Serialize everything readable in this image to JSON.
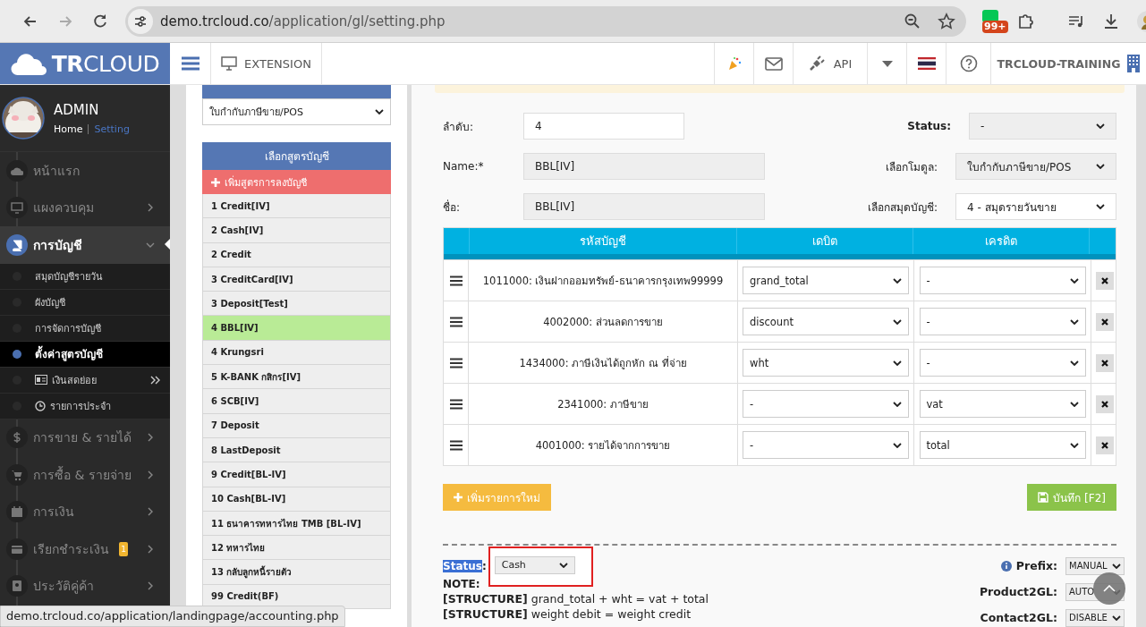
{
  "browser": {
    "url_domain": "demo.trcloud.co",
    "url_path": "/application/gl/setting.php",
    "extension_badge": "99+"
  },
  "header": {
    "logo": "**TR**CLOUD",
    "extension": "EXTENSION",
    "api": "API",
    "company": "TRCLOUD-TRAINING"
  },
  "profile": {
    "name": "ADMIN",
    "home": "Home",
    "setting": "Setting"
  },
  "sidebar": {
    "items": [
      {
        "label": "หน้าแรก",
        "kind": "link",
        "selected": false
      },
      {
        "label": "แผงควบคุม",
        "kind": "menu",
        "selected": false,
        "expanded": false
      },
      {
        "label": "การบัญชี",
        "kind": "menu",
        "selected": true,
        "expanded": true,
        "children": [
          {
            "label": "สมุดบัญชีรายวัน",
            "kind": "plain",
            "selected": false
          },
          {
            "label": "ผังบัญชี",
            "kind": "plain",
            "selected": false
          },
          {
            "label": "การจัดการบัญชี",
            "kind": "plain",
            "selected": false
          },
          {
            "label": "ตั้งค่าสูตรบัญชี",
            "kind": "plain",
            "selected": true
          },
          {
            "label": "เงินสดย่อย",
            "kind": "submenu",
            "selected": false
          },
          {
            "label": "รายการประจำ",
            "kind": "icon",
            "selected": false
          }
        ]
      },
      {
        "label": "การขาย & รายได้",
        "kind": "menu",
        "selected": false,
        "expanded": false
      },
      {
        "label": "การซื้อ & รายจ่าย",
        "kind": "menu",
        "selected": false,
        "expanded": false
      },
      {
        "label": "การเงิน",
        "kind": "menu",
        "selected": false,
        "expanded": false
      },
      {
        "label": "เรียกชำระเงิน",
        "kind": "menu",
        "selected": false,
        "expanded": false,
        "badge": "1"
      },
      {
        "label": "ประวัติคู่ค้า",
        "kind": "menu",
        "selected": false,
        "expanded": false
      }
    ]
  },
  "module_select": {
    "value": "ใบกำกับภาษีขาย/POS"
  },
  "formulas": {
    "title": "เลือกสูตรบัญชี",
    "add_label": "เพิ่มสูตรการลงบัญชี",
    "items": [
      {
        "label": "1 Credit[IV]",
        "selected": false
      },
      {
        "label": "2 Cash[IV]",
        "selected": false
      },
      {
        "label": "2 Credit",
        "selected": false
      },
      {
        "label": "3 CreditCard[IV]",
        "selected": false
      },
      {
        "label": "3 Deposit[Test]",
        "selected": false
      },
      {
        "label": "4 BBL[IV]",
        "selected": true
      },
      {
        "label": "4 Krungsri",
        "selected": false
      },
      {
        "label": "5 K-BANK กสิกร[IV]",
        "selected": false
      },
      {
        "label": "6 SCB[IV]",
        "selected": false
      },
      {
        "label": "7 Deposit",
        "selected": false
      },
      {
        "label": "8 LastDeposit",
        "selected": false
      },
      {
        "label": "9 Credit[BL-IV]",
        "selected": false
      },
      {
        "label": "10 Cash[BL-IV]",
        "selected": false
      },
      {
        "label": "11 ธนาคารทหารไทย TMB [BL-IV]",
        "selected": false
      },
      {
        "label": "12 ทหารไทย",
        "selected": false
      },
      {
        "label": "13 กลับลูกหนี้รายตัว",
        "selected": false
      },
      {
        "label": "99 Credit(BF)",
        "selected": false
      }
    ]
  },
  "form": {
    "rows": [
      {
        "left": {
          "label": "ลำดับ:",
          "value": "4",
          "kind": "input"
        },
        "right": {
          "label": "Status:",
          "value": "-",
          "kind": "select_grey",
          "bold": true
        }
      },
      {
        "left": {
          "label": "Name:*",
          "value": "BBL[IV]",
          "kind": "readonly"
        },
        "right": {
          "label": "เลือกโมดูล:",
          "value": "ใบกำกับภาษีขาย/POS",
          "kind": "select_grey",
          "bold": false
        }
      },
      {
        "left": {
          "label": "ชื่อ:",
          "value": "BBL[IV]",
          "kind": "readonly"
        },
        "right": {
          "label": "เลือกสมุดบัญชี:",
          "value": "4 - สมุดรายวันขาย",
          "kind": "select",
          "bold": false
        }
      }
    ]
  },
  "table": {
    "columns": [
      "รหัสบัญชี",
      "เดบิต",
      "เครดิต"
    ],
    "rows": [
      {
        "account": "1011000: เงินฝากออมทรัพย์-ธนาคารกรุงเทพ99999",
        "debit": "grand_total",
        "credit": "-"
      },
      {
        "account": "4002000: ส่วนลดการขาย",
        "debit": "discount",
        "credit": "-"
      },
      {
        "account": "1434000: ภาษีเงินได้ถูกหัก ณ ที่จ่าย",
        "debit": "wht",
        "credit": "-"
      },
      {
        "account": "2341000: ภาษีขาย",
        "debit": "-",
        "credit": "vat"
      },
      {
        "account": "4001000: รายได้จากการขาย",
        "debit": "-",
        "credit": "total"
      }
    ]
  },
  "buttons": {
    "add_row": "เพิ่มรายการใหม่",
    "save": "บันทึก [F2]"
  },
  "footer": {
    "status_label": "Status",
    "status_suffix": ":",
    "highlighted": true,
    "status_value": "Cash",
    "note": "NOTE:",
    "lines": [
      "**[STRUCTURE]** grand_total + wht = vat + total",
      "**[STRUCTURE]** weight debit = weight credit"
    ],
    "settings": [
      {
        "label": "Prefix:",
        "value": "MANUAL"
      },
      {
        "label": "Product2GL:",
        "value": "AUTO"
      },
      {
        "label": "Contact2GL:",
        "value": "DISABLE"
      }
    ]
  },
  "status_bar": "demo.trcloud.co/application/landingpage/accounting.php"
}
